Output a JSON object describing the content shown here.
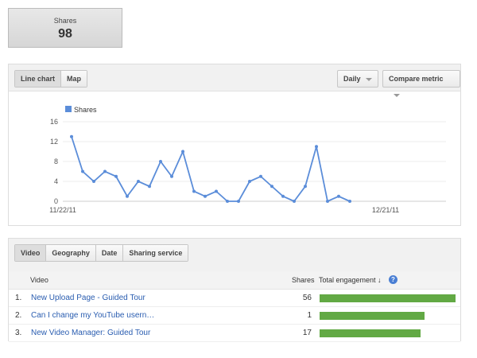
{
  "kpi": {
    "label": "Shares",
    "value": "98"
  },
  "chart_controls": {
    "line_chart": "Line chart",
    "map": "Map",
    "daily": "Daily",
    "compare": "Compare metric"
  },
  "chart_data": {
    "type": "line",
    "legend": "Shares",
    "series": [
      {
        "name": "Shares",
        "values": [
          13,
          6,
          4,
          6,
          5,
          1,
          4,
          3,
          8,
          5,
          10,
          2,
          1,
          2,
          0,
          0,
          4,
          5,
          3,
          1,
          0,
          3,
          11,
          0,
          1,
          0
        ]
      }
    ],
    "x_start_label": "11/22/11",
    "x_end_label": "12/21/11",
    "x_days": 30,
    "yticks": [
      "16",
      "12",
      "8",
      "4",
      "0"
    ],
    "ylim": [
      0,
      16
    ],
    "color": "#5b8dd9"
  },
  "table_tabs": [
    "Video",
    "Geography",
    "Date",
    "Sharing service"
  ],
  "table": {
    "headers": {
      "video": "Video",
      "shares": "Shares",
      "engagement": "Total engagement ↓"
    },
    "rows": [
      {
        "rank": "1.",
        "title": "New Upload Page - Guided Tour",
        "shares": "56",
        "engagement": 1.0
      },
      {
        "rank": "2.",
        "title": "Can I change my YouTube usern…",
        "shares": "1",
        "engagement": 0.77
      },
      {
        "rank": "3.",
        "title": "New Video Manager: Guided Tour",
        "shares": "17",
        "engagement": 0.74
      }
    ]
  }
}
